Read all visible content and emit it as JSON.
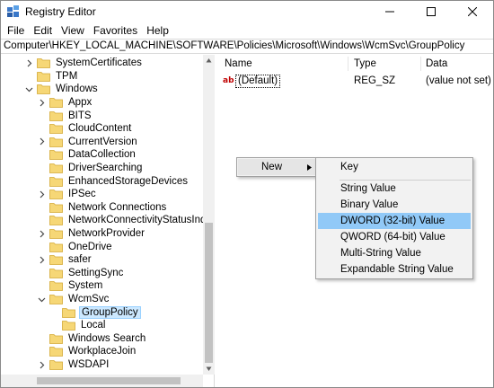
{
  "window": {
    "title": "Registry Editor"
  },
  "menubar": {
    "items": [
      "File",
      "Edit",
      "View",
      "Favorites",
      "Help"
    ]
  },
  "address": {
    "path": "Computer\\HKEY_LOCAL_MACHINE\\SOFTWARE\\Policies\\Microsoft\\Windows\\WcmSvc\\GroupPolicy"
  },
  "tree": {
    "items": [
      {
        "label": "SystemCertificates",
        "expandable": true
      },
      {
        "label": "TPM",
        "expandable": false
      },
      {
        "label": "Windows",
        "expandable": true,
        "expanded": true
      },
      {
        "label": "Appx",
        "expandable": true
      },
      {
        "label": "BITS",
        "expandable": false
      },
      {
        "label": "CloudContent",
        "expandable": false
      },
      {
        "label": "CurrentVersion",
        "expandable": true
      },
      {
        "label": "DataCollection",
        "expandable": false
      },
      {
        "label": "DriverSearching",
        "expandable": false
      },
      {
        "label": "EnhancedStorageDevices",
        "expandable": false
      },
      {
        "label": "IPSec",
        "expandable": true
      },
      {
        "label": "Network Connections",
        "expandable": false
      },
      {
        "label": "NetworkConnectivityStatusIndicator",
        "expandable": false
      },
      {
        "label": "NetworkProvider",
        "expandable": true
      },
      {
        "label": "OneDrive",
        "expandable": false
      },
      {
        "label": "safer",
        "expandable": true
      },
      {
        "label": "SettingSync",
        "expandable": false
      },
      {
        "label": "System",
        "expandable": false
      },
      {
        "label": "WcmSvc",
        "expandable": true,
        "expanded": true
      },
      {
        "label": "GroupPolicy",
        "expandable": false,
        "selected": true
      },
      {
        "label": "Local",
        "expandable": false
      },
      {
        "label": "Windows Search",
        "expandable": false
      },
      {
        "label": "WorkplaceJoin",
        "expandable": false
      },
      {
        "label": "WSDAPI",
        "expandable": true
      }
    ]
  },
  "list": {
    "columns": [
      "Name",
      "Type",
      "Data"
    ],
    "rows": [
      {
        "name": "(Default)",
        "type": "REG_SZ",
        "data": "(value not set)",
        "icon": "string-value-icon"
      }
    ]
  },
  "context_menu": {
    "parent_label": "New",
    "submenu": [
      {
        "label": "Key"
      },
      {
        "label": "String Value"
      },
      {
        "label": "Binary Value"
      },
      {
        "label": "DWORD (32-bit) Value",
        "highlighted": true
      },
      {
        "label": "QWORD (64-bit) Value"
      },
      {
        "label": "Multi-String Value"
      },
      {
        "label": "Expandable String Value"
      }
    ]
  },
  "colors": {
    "selection": "#cce8ff",
    "menu_highlight": "#91c9f7",
    "folder": "#f6d776",
    "default_icon": "#c00000"
  }
}
